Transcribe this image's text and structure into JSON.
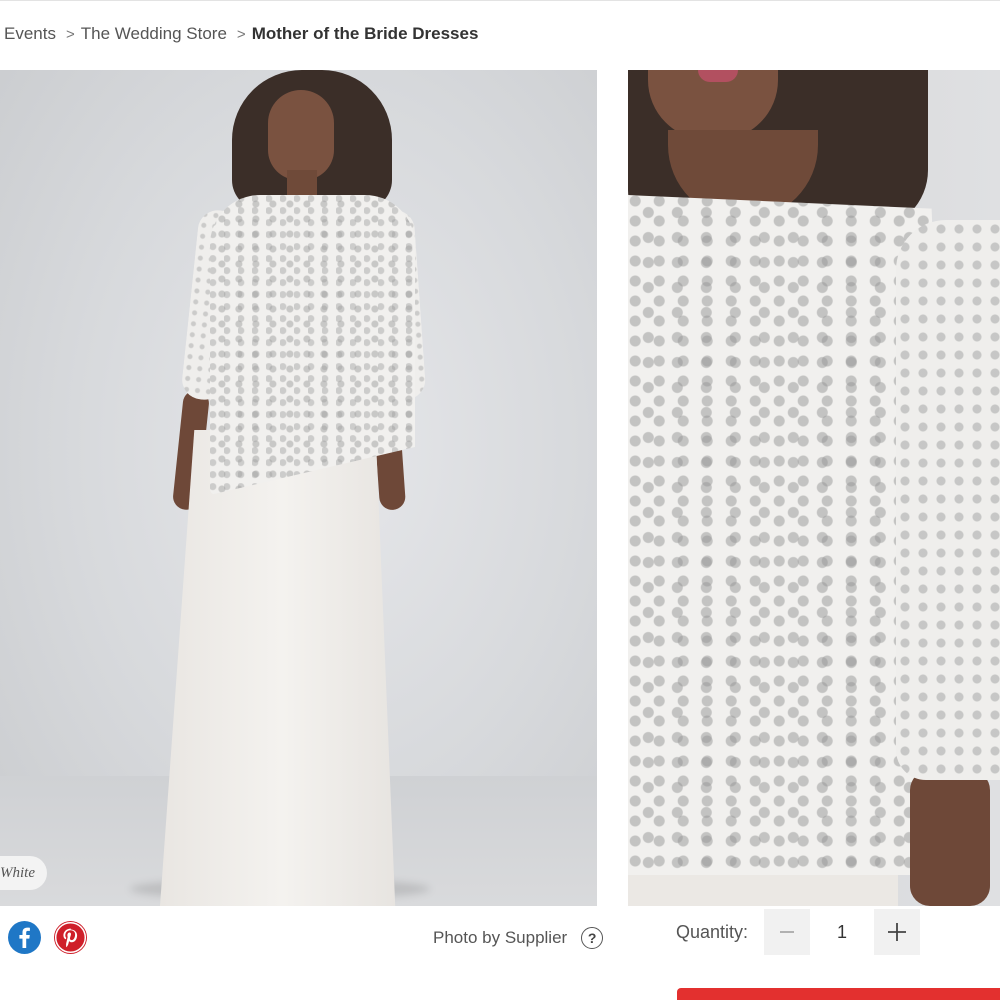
{
  "breadcrumb": {
    "items": [
      "Events",
      "The Wedding Store",
      "Mother of the Bride Dresses"
    ],
    "separator": ">"
  },
  "product_images": {
    "selected_color": "White",
    "photo_credit": "Photo by Supplier"
  },
  "share": {
    "icons": [
      "facebook-icon",
      "pinterest-icon"
    ]
  },
  "quantity": {
    "label": "Quantity:",
    "value": "1",
    "decrement_symbol": "−",
    "increment_symbol": "+"
  },
  "colors": {
    "facebook": "#1f77c6",
    "pinterest": "#cf1f2a",
    "cta": "#e3302f"
  }
}
